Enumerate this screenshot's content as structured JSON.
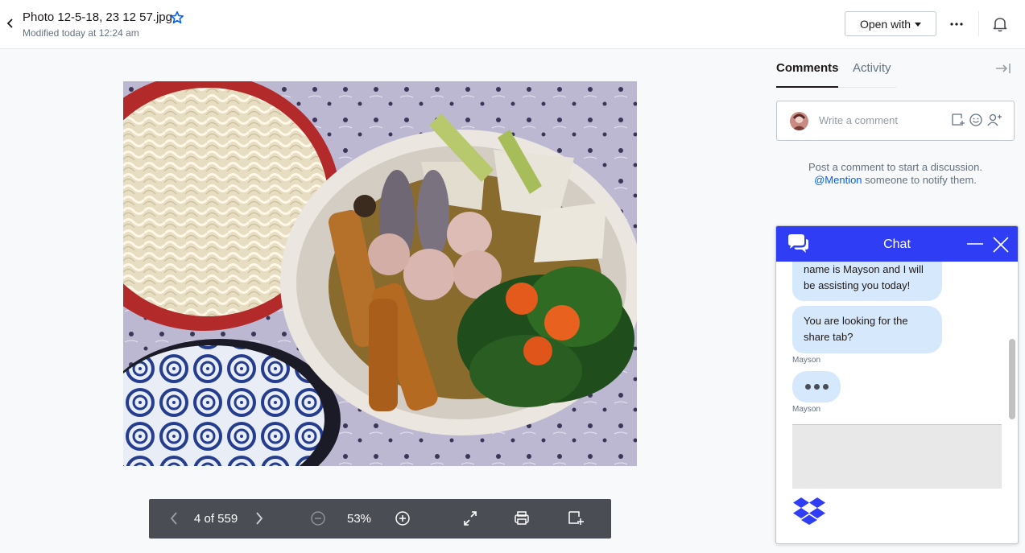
{
  "header": {
    "file_name": "Photo 12-5-18, 23 12 57.jpg",
    "modified": "Modified today at 12:24 am",
    "open_with_label": "Open with"
  },
  "toolbar": {
    "page_counter": "4 of 559",
    "zoom": "53%"
  },
  "comments_panel": {
    "tabs": [
      {
        "label": "Comments",
        "active": true
      },
      {
        "label": "Activity",
        "active": false
      }
    ],
    "comment_placeholder": "Write a comment",
    "empty_line1": "Post a comment to start a discussion.",
    "mention_link": "@Mention",
    "empty_line2_rest": "someone to notify them."
  },
  "chat": {
    "title": "Chat",
    "messages": [
      {
        "text": "name is Mayson and I will be assisting you today!"
      },
      {
        "text": "You are looking for the share tab?"
      }
    ],
    "sender_1": "Mayson",
    "sender_2": "Mayson"
  },
  "colors": {
    "accent_blue": "#0061fe",
    "chat_header": "#2f3df5",
    "bubble": "#d6e8fc",
    "toolbar_bg": "#4a4e54"
  },
  "icons": {
    "back": "chevron-left-icon",
    "star": "star-icon",
    "more": "ellipsis-icon",
    "bell": "bell-icon",
    "prev": "chevron-left-icon",
    "next": "chevron-right-icon",
    "zoom_out": "zoom-out-icon",
    "zoom_in": "zoom-in-icon",
    "fullscreen": "fullscreen-icon",
    "print": "print-icon",
    "comment_add": "add-comment-icon",
    "collapse": "collapse-panel-icon",
    "emoji": "emoji-icon",
    "mention_user": "add-person-icon",
    "chat_logo": "chat-bubbles-icon",
    "minimize": "minimize-icon",
    "close": "close-icon",
    "dropbox": "dropbox-logo-icon"
  }
}
